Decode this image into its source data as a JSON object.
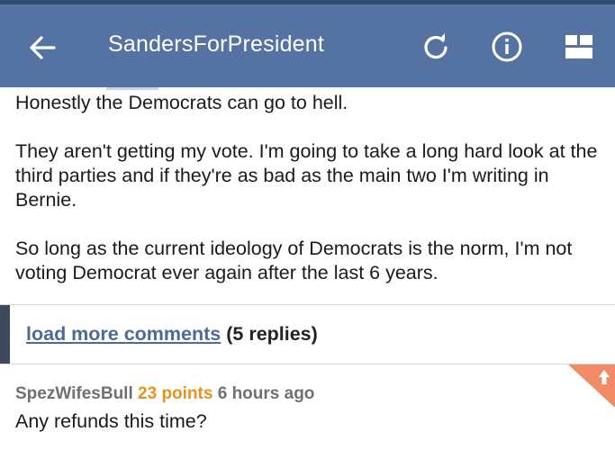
{
  "appbar": {
    "title": "SandersForPresident",
    "background": "#5473a2",
    "icons": [
      "back-arrow-icon",
      "refresh-icon",
      "info-icon",
      "layout-icon"
    ]
  },
  "comment": {
    "paragraphs": [
      "Honestly the Democrats can go to hell.",
      "They aren't getting my vote. I'm going to take a long hard look at the third parties and if they're as bad as the main two I'm writing in Bernie.",
      "So long as the current ideology of Democrats is the norm, I'm not voting Democrat ever again after the last 6 years."
    ]
  },
  "load_more": {
    "link_label": "load more comments",
    "count_label": "(5 replies)"
  },
  "reply": {
    "author": "SpezWifesBull",
    "points": "23 points",
    "time": "6 hours ago",
    "text": "Any refunds this time?",
    "points_color": "#e8921a",
    "upvote_color": "#f08a67"
  }
}
